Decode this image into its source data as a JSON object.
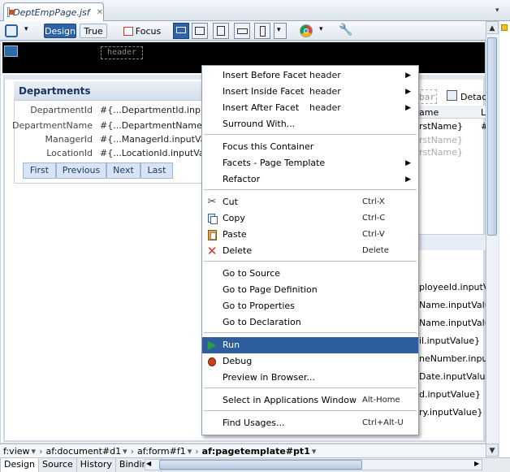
{
  "editor_tab": {
    "title": "DeptEmpPage.jsf",
    "close": "✕"
  },
  "toolbar": {
    "design": "Design",
    "true": "True",
    "focus": "Focus"
  },
  "canvas": {
    "header_facet": "header"
  },
  "departments": {
    "title": "Departments",
    "fields": [
      {
        "label": "DepartmentId",
        "value": "#{...DepartmentId.inputValue}"
      },
      {
        "label": "DepartmentName",
        "value": "#{...DepartmentName.inputValue}"
      },
      {
        "label": "ManagerId",
        "value": "#{...ManagerId.inputValue}"
      },
      {
        "label": "LocationId",
        "value": "#{...LocationId.inputValue}"
      }
    ],
    "nav": [
      "First",
      "Previous",
      "Next",
      "Last"
    ]
  },
  "right_fragments": {
    "bar": "bar",
    "detach": "Detac",
    "name_col": "ame",
    "l_col": "L",
    "first_name": "rstName}",
    "hash": "#",
    "first_name2": "rstName}",
    "first_name3": "rstName}",
    "rows": [
      "ployeeId.inputValue",
      "Name.inputValue",
      "Name.inputValue",
      "il.inputValue}",
      "neNumber.inputValue",
      "Date.inputValue}",
      "d.inputValue}",
      "ry.inputValue}"
    ]
  },
  "context_menu": {
    "items": [
      {
        "label": "Insert Before Facet",
        "hint": "header",
        "submenu": true
      },
      {
        "label": "Insert Inside Facet",
        "hint": "header",
        "submenu": true
      },
      {
        "label": "Insert After Facet",
        "hint": "header",
        "submenu": true
      },
      {
        "label": "Surround With..."
      },
      {
        "label": "Focus this Container"
      },
      {
        "label": "Facets - Page Template",
        "submenu": true
      },
      {
        "label": "Refactor",
        "submenu": true
      },
      {
        "label": "Cut",
        "shortcut": "Ctrl-X",
        "icon": "scissors-icon"
      },
      {
        "label": "Copy",
        "shortcut": "Ctrl-C",
        "icon": "copy-icon"
      },
      {
        "label": "Paste",
        "shortcut": "Ctrl-V",
        "icon": "paste-icon"
      },
      {
        "label": "Delete",
        "shortcut": "Delete",
        "icon": "delete-icon"
      },
      {
        "label": "Go to Source"
      },
      {
        "label": "Go to Page Definition"
      },
      {
        "label": "Go to Properties"
      },
      {
        "label": "Go to Declaration"
      },
      {
        "label": "Run",
        "icon": "run-icon",
        "highlighted": true
      },
      {
        "label": "Debug",
        "icon": "debug-icon"
      },
      {
        "label": "Preview in Browser..."
      },
      {
        "label": "Select in Applications Window",
        "shortcut": "Alt-Home"
      },
      {
        "label": "Find Usages...",
        "shortcut": "Ctrl+Alt-U"
      }
    ]
  },
  "breadcrumbs": [
    "f:view",
    "af:document#d1",
    "af:form#f1",
    "af:pagetemplate#pt1"
  ],
  "bottom_tabs": [
    "Design",
    "Source",
    "History",
    "Bindings"
  ],
  "colors": {
    "accent": "#2e5e9e",
    "run_green": "#2ea043",
    "delete_red": "#d8322a"
  }
}
